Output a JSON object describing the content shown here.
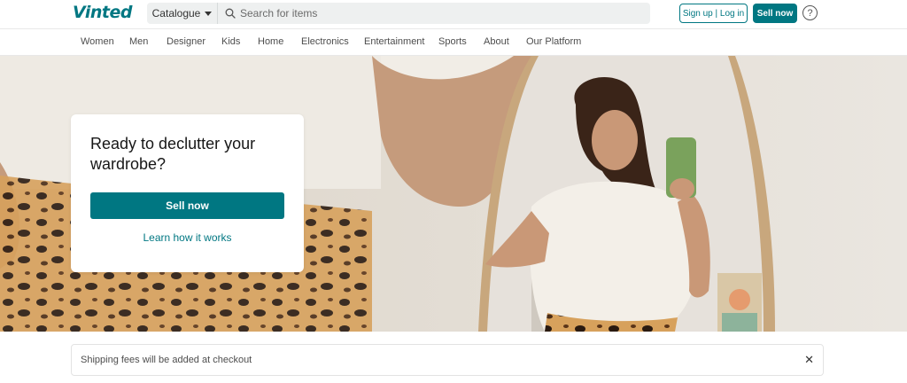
{
  "brand": {
    "logo_text": "Vinted",
    "accent": "#007782"
  },
  "header": {
    "catalogue_label": "Catalogue",
    "search_placeholder": "Search for items",
    "signup_label": "Sign up | Log in",
    "sell_label": "Sell now",
    "help_label": "?"
  },
  "nav": {
    "items": [
      "Women",
      "Men",
      "Designer",
      "Kids",
      "Home",
      "Electronics",
      "Entertainment",
      "Sports",
      "About",
      "Our Platform"
    ]
  },
  "hero": {
    "title": "Ready to declutter your wardrobe?",
    "sell_label": "Sell now",
    "learn_label": "Learn how it works"
  },
  "notice": {
    "text": "Shipping fees will be added at checkout",
    "close_label": "✕"
  }
}
